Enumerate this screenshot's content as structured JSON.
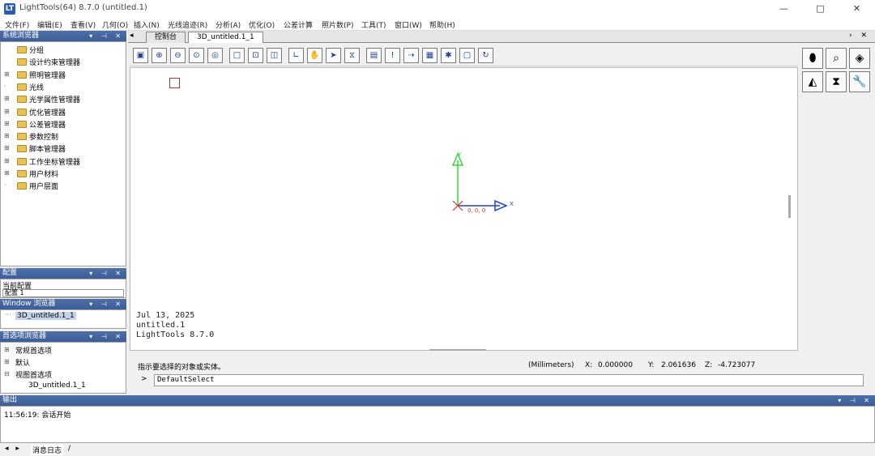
{
  "window": {
    "title": "LightTools(64) 8.7.0 (untitled.1)",
    "app_icon": "LT",
    "controls": [
      "—",
      "□",
      "✕"
    ]
  },
  "menu": [
    "文件(F)",
    "编辑(E)",
    "查看(V)",
    "几何(O)",
    "插入(N)",
    "光线追迹(R)",
    "分析(A)",
    "优化(O)",
    "公差计算",
    "照片数(P)",
    "工具(T)",
    "窗口(W)",
    "帮助(H)"
  ],
  "system_navigator": {
    "title": "系统浏览器",
    "header_buttons": "▾ ⊣ ✕",
    "items": [
      {
        "label": "分组",
        "expand": ""
      },
      {
        "label": "设计约束管理器",
        "expand": ""
      },
      {
        "label": "照明管理器",
        "expand": "⊞"
      },
      {
        "label": "光线",
        "expand": "·"
      },
      {
        "label": "光学属性管理器",
        "expand": "⊞"
      },
      {
        "label": "优化管理器",
        "expand": "⊞"
      },
      {
        "label": "公差管理器",
        "expand": "⊞"
      },
      {
        "label": "参数控制",
        "expand": "⊞"
      },
      {
        "label": "脚本管理器",
        "expand": "⊞"
      },
      {
        "label": "工作坐标管理器",
        "expand": "⊞"
      },
      {
        "label": "用户材料",
        "expand": "⊞"
      },
      {
        "label": "用户层面",
        "expand": "·"
      }
    ]
  },
  "layers_panel": {
    "title": "配置",
    "current_label": "当前配置",
    "current_value": "配置 1"
  },
  "window_browser": {
    "title": "Window 浏览器",
    "item": "3D_untitled.1_1"
  },
  "options_browser": {
    "title": "首选项浏览器",
    "items": [
      {
        "label": "常规首选项",
        "expand": "⊞"
      },
      {
        "label": "默认",
        "expand": "⊞"
      },
      {
        "label": "视图首选项",
        "expand": "⊟"
      },
      {
        "label": "3D_untitled.1_1",
        "expand": ""
      }
    ]
  },
  "tabs": [
    {
      "label": "控制台",
      "active": false
    },
    {
      "label": "3D_untitled.1_1",
      "active": true
    }
  ],
  "tab_nav": "◂",
  "tab_controls": "› ✕",
  "toolbar_icons": [
    "save-icon",
    "zoom-in-icon",
    "zoom-out-icon",
    "zoom-window-icon",
    "zoom-fit-icon",
    "rectangle-icon",
    "frame-icon",
    "cube-icon",
    "axis-icon",
    "pan-icon",
    "select-arrow-icon",
    "lens-icon",
    "panel-icon",
    "info-icon",
    "ray-icon",
    "grid-icon",
    "bug-icon",
    "snapshot-icon",
    "refresh-icon"
  ],
  "viewport": {
    "axis_y": "Y",
    "axis_x": "X",
    "origin_label": "0, 0, 0",
    "date": "Jul 13, 2025",
    "file": "untitled.1",
    "version": "LightTools 8.7.0"
  },
  "palette_icons": [
    "lens-tool-icon",
    "analysis-tool-icon",
    "cube-tool-icon",
    "mirror-tool-icon",
    "lens-group-icon",
    "wrench-tool-icon"
  ],
  "status": {
    "message": "指示要选择的对象或实体。",
    "units": "(Millimeters)",
    "x_label": "X:",
    "x_value": "0.000000",
    "y_label": "Y:",
    "y_value": "2.061636",
    "z_label": "Z:",
    "z_value": "-4.723077"
  },
  "command": {
    "prompt": ">",
    "value": "DefaultSelect"
  },
  "output": {
    "title": "输出",
    "header_buttons": "▾ ⊣ ✕",
    "log_line": "11:56:19: 会话开始"
  },
  "output_tabs": {
    "nav": "◂ ▸",
    "label": "消息日志",
    "separator": "/"
  }
}
